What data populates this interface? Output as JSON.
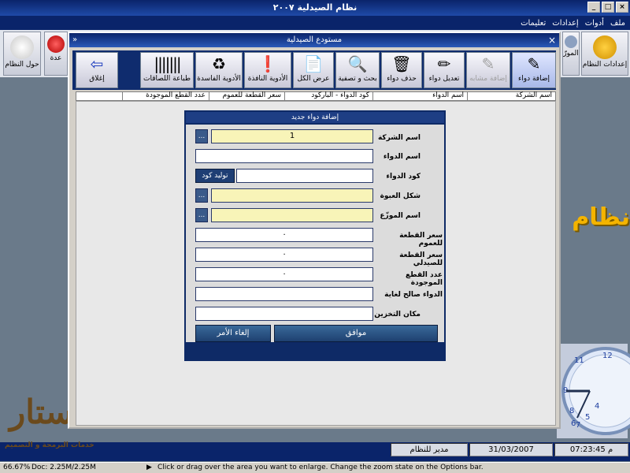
{
  "window": {
    "title": "نظام الصيدلية ٢٠٠٧"
  },
  "menu": [
    "ملف",
    "أدوات",
    "إعدادات",
    "تعليمات"
  ],
  "main_buttons": {
    "settings": "إعدادات النظام",
    "suppliers": "المورّ",
    "about": "حول النظام",
    "third": "عدة"
  },
  "brand_text": "نظام",
  "child": {
    "title": "مستودع الصيدلية",
    "toolbar": {
      "add": "إضافة دواء",
      "add_similar": "إضافة مشابه",
      "edit": "تعديل دواء",
      "delete": "حذف دواء",
      "search": "بحث و تصفية",
      "show_all": "عرض الكل",
      "expired": "الأدوية النافذة",
      "damaged": "الأدوية الفاسدة",
      "labels": "طباعة اللصاقات",
      "close": "إغلاق"
    },
    "columns": [
      "اسم الشركة",
      "اسم الدواء",
      "كود الدواء - الباركود",
      "سعر القطعة للعموم",
      "عدد القطع الموجودة"
    ]
  },
  "dialog": {
    "title": "إضافة دواء جديد",
    "fields": {
      "company": {
        "label": "اسم الشركة",
        "value": "1"
      },
      "drug_name": {
        "label": "اسم الدواء",
        "value": ""
      },
      "drug_code": {
        "label": "كود الدواء",
        "value": ""
      },
      "package_form": {
        "label": "شكل العبوة",
        "value": ""
      },
      "supplier": {
        "label": "اسم الموزّع",
        "value": ""
      },
      "public_price": {
        "label": "سعر القطعة للعموم",
        "value": "٠"
      },
      "pharmacist_price": {
        "label": "سعر القطعة للصيدلي",
        "value": "٠"
      },
      "quantity": {
        "label": "عدد القطع الموجودة",
        "value": "٠"
      },
      "valid_until": {
        "label": "الدواء صالح لغاية",
        "value": ""
      },
      "storage": {
        "label": "مكان التخزين",
        "value": ""
      }
    },
    "dots": "...",
    "generate_code": "توليد كود",
    "ok": "موافق",
    "cancel": "إلغاء الأمر"
  },
  "bottom": {
    "user": "مدير للنظام",
    "date": "31/03/2007",
    "time": "07:23:45",
    "ampm": "م"
  },
  "logo": {
    "big": "ستار",
    "small": "خدمات البرمجة و التصميم"
  },
  "status": {
    "zoom": "66.67%",
    "doc": "Doc: 2.25M/2.25M",
    "hint": "Click or drag over the area you want to enlarge. Change the zoom state on the Options bar."
  }
}
